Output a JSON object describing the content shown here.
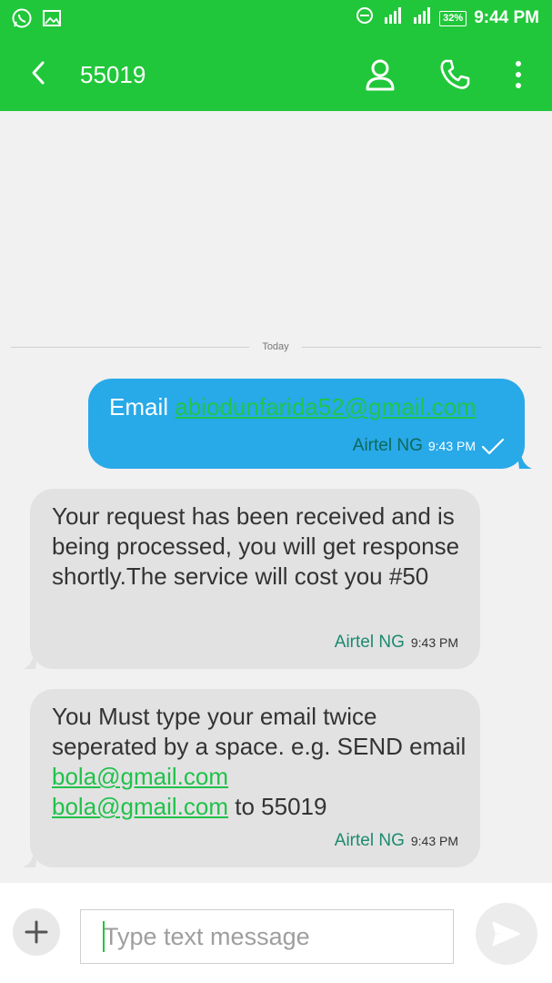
{
  "status_bar": {
    "time": "9:44 PM",
    "battery": "32%",
    "icons": [
      "whatsapp-icon",
      "gallery-icon",
      "dnd-icon",
      "signal-icon",
      "signal-icon-2"
    ]
  },
  "app_bar": {
    "title": "55019",
    "icons": [
      "back-arrow-icon",
      "contact-icon",
      "phone-icon",
      "more-vert-icon"
    ]
  },
  "date_divider": "Today",
  "messages": [
    {
      "direction": "sent",
      "prefix": "Email ",
      "link": "abiodunfarida52@gmail.com",
      "sender": "Airtel NG",
      "time": "9:43 PM",
      "status_icon": "check-icon"
    },
    {
      "direction": "received",
      "text": "Your request has been received and is being processed, you will get response shortly.The service will cost you #50",
      "sender": "Airtel NG",
      "time": "9:43 PM"
    },
    {
      "direction": "received",
      "text_1": "You Must type your email twice seperated by a space. e.g. SEND email ",
      "link_1": "bola@gmail.com",
      "link_2": "bola@gmail.com",
      "text_2": " to 55019",
      "sender": "Airtel NG",
      "time": "9:43 PM"
    }
  ],
  "compose": {
    "placeholder": "Type text message"
  },
  "colors": {
    "accent": "#21c73a",
    "sent_bubble": "#28a9e8",
    "received_bubble": "#e2e2e2"
  }
}
